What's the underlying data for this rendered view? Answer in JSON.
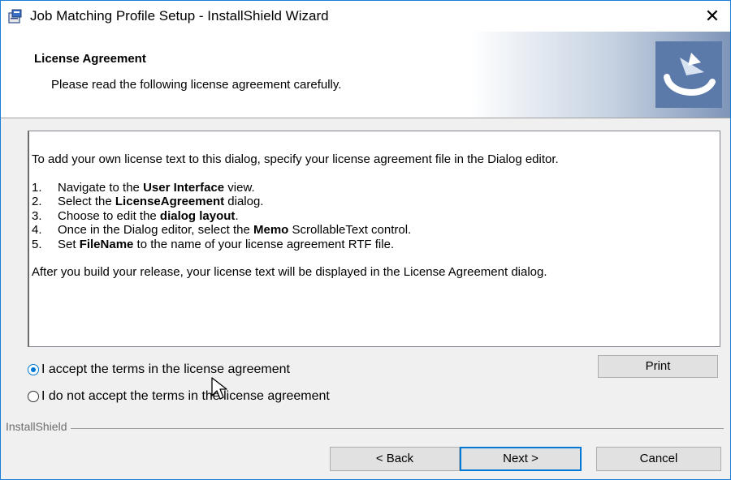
{
  "window": {
    "title": "Job Matching Profile Setup - InstallShield Wizard",
    "close_icon": "close-icon",
    "app_icon": "installer-box-icon"
  },
  "banner": {
    "title": "License Agreement",
    "subtitle": "Please read the following license agreement carefully.",
    "logo_icon": "installshield-logo-icon"
  },
  "license": {
    "intro": "To add your own license text to this dialog, specify your license agreement file in the Dialog editor.",
    "steps": [
      {
        "num": "1.",
        "pre": "Navigate to the ",
        "bold": "User Interface",
        "post": " view."
      },
      {
        "num": "2.",
        "pre": "Select the ",
        "bold": "LicenseAgreement",
        "post": " dialog."
      },
      {
        "num": "3.",
        "pre": "Choose to edit the ",
        "bold": "dialog layout",
        "post": "."
      },
      {
        "num": "4.",
        "pre": "Once in the Dialog editor, select the ",
        "bold": "Memo",
        "post": " ScrollableText control."
      },
      {
        "num": "5.",
        "pre": "Set ",
        "bold": "FileName",
        "post": " to the name of your license agreement RTF file."
      }
    ],
    "outro": "After you build your release, your license text will be displayed in the License Agreement dialog."
  },
  "options": {
    "accept_label": "I accept the terms in the license agreement",
    "decline_label": "I do not accept the terms in the license agreement",
    "selected": "accept"
  },
  "buttons": {
    "print": "Print",
    "back": "< Back",
    "next": "Next >",
    "cancel": "Cancel"
  },
  "footer": {
    "brand": "InstallShield"
  },
  "colors": {
    "accent": "#0078d7",
    "window_border": "#1c7dd6",
    "dialog_bg": "#f0f0f0"
  }
}
